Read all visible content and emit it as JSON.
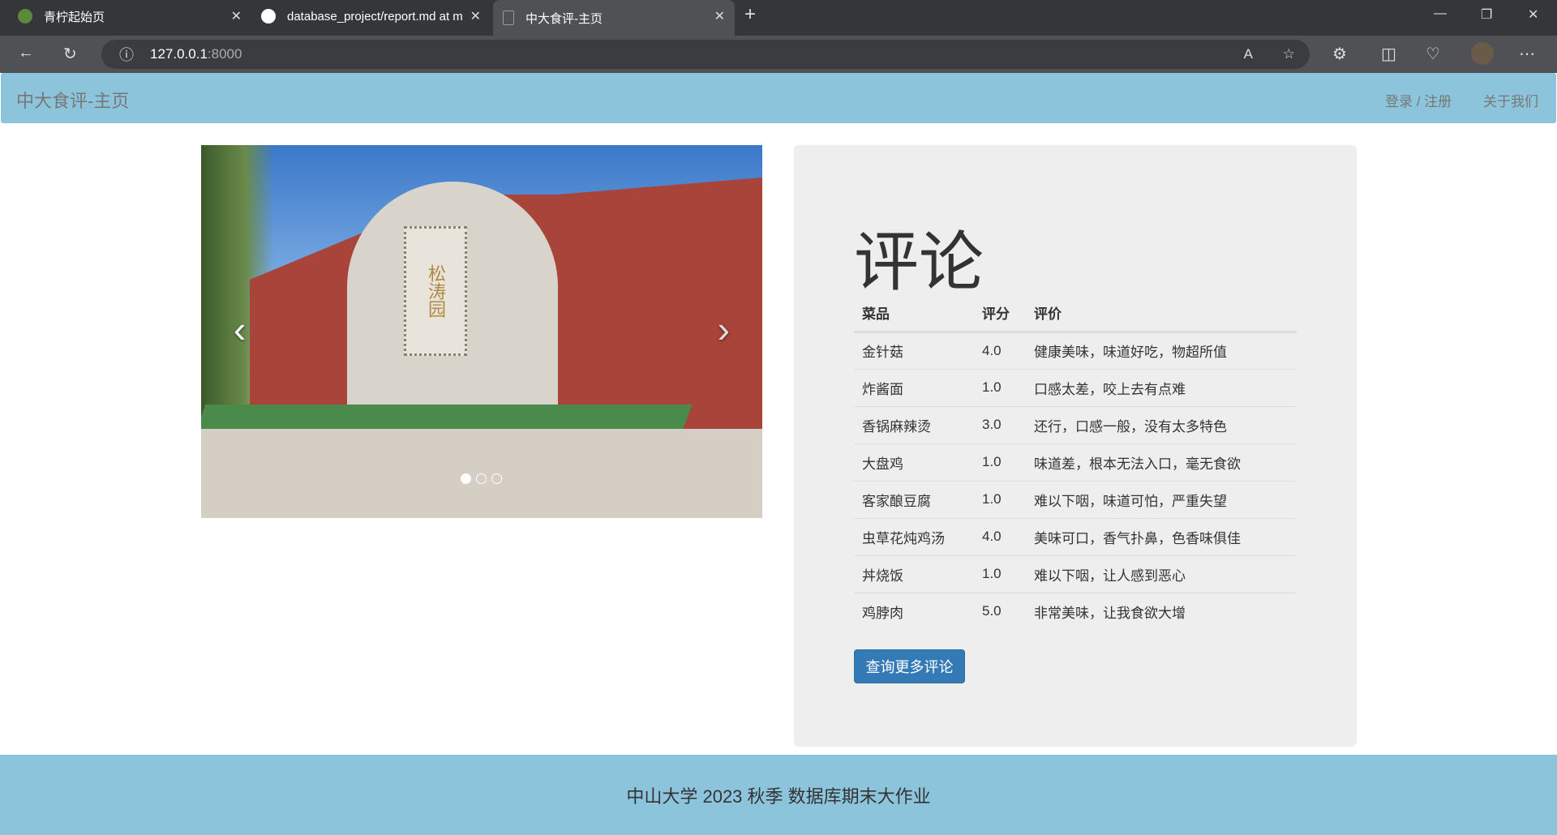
{
  "browser": {
    "tabs": [
      {
        "title": "青柠起始页",
        "active": false
      },
      {
        "title": "database_project/report.md at m",
        "active": false
      },
      {
        "title": "中大食评-主页",
        "active": true
      }
    ],
    "url_host": "127.0.0.1",
    "url_port": ":8000"
  },
  "navbar": {
    "brand": "中大食评-主页",
    "links": [
      "登录 / 注册",
      "关于我们"
    ]
  },
  "carousel": {
    "slide_count": 3,
    "active_slide": 1,
    "sign_text": "松涛园"
  },
  "reviews": {
    "title": "评论",
    "headers": [
      "菜品",
      "评分",
      "评价"
    ],
    "rows": [
      [
        "金针菇",
        "4.0",
        "健康美味，味道好吃，物超所值"
      ],
      [
        "炸酱面",
        "1.0",
        "口感太差，咬上去有点难"
      ],
      [
        "香锅麻辣烫",
        "3.0",
        "还行，口感一般，没有太多特色"
      ],
      [
        "大盘鸡",
        "1.0",
        "味道差，根本无法入口，毫无食欲"
      ],
      [
        "客家酿豆腐",
        "1.0",
        "难以下咽，味道可怕，严重失望"
      ],
      [
        "虫草花炖鸡汤",
        "4.0",
        "美味可口，香气扑鼻，色香味俱佳"
      ],
      [
        "丼烧饭",
        "1.0",
        "难以下咽，让人感到恶心"
      ],
      [
        "鸡脖肉",
        "5.0",
        "非常美味，让我食欲大增"
      ]
    ],
    "more_button": "查询更多评论"
  },
  "footer": {
    "text": "中山大学 2023 秋季 数据库期末大作业"
  }
}
